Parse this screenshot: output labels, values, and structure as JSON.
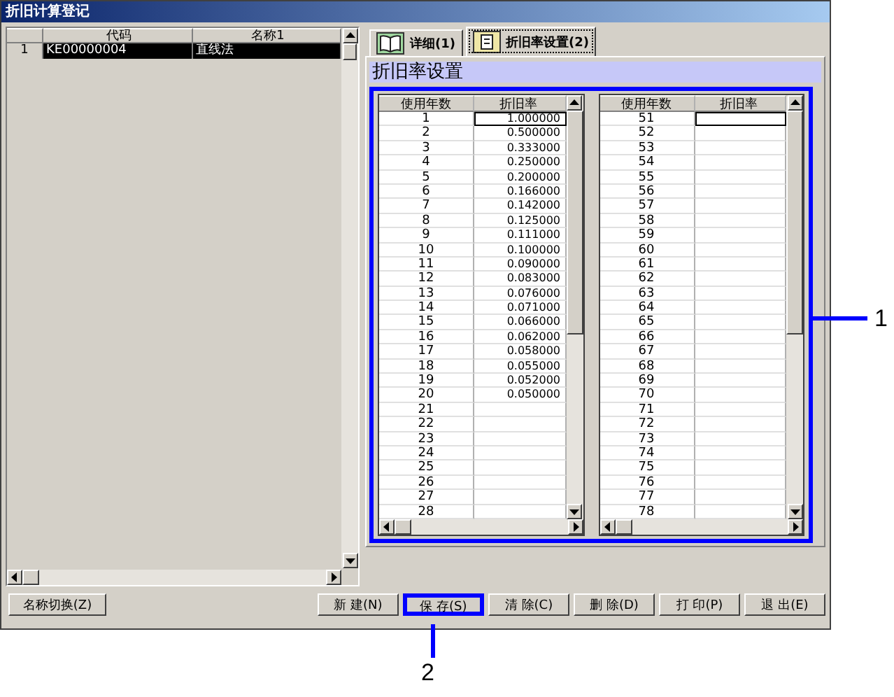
{
  "window": {
    "title": "折旧计算登记"
  },
  "list": {
    "columns": [
      "代码",
      "名称1"
    ],
    "rows": [
      {
        "index": "1",
        "code": "KE00000004",
        "name": "直线法",
        "selected": true
      }
    ]
  },
  "tabs": [
    {
      "label": "详细(1)",
      "selected": false
    },
    {
      "label": "折旧率设置(2)",
      "selected": true
    }
  ],
  "section_title": "折旧率设置",
  "rate_panel_highlighted": true,
  "rate_tables": [
    {
      "columns": [
        "使用年数",
        "折旧率"
      ],
      "rows": [
        {
          "years": "1",
          "rate": "1.000000",
          "focused": true
        },
        {
          "years": "2",
          "rate": "0.500000",
          "focused": false
        },
        {
          "years": "3",
          "rate": "0.333000",
          "focused": false
        },
        {
          "years": "4",
          "rate": "0.250000",
          "focused": false
        },
        {
          "years": "5",
          "rate": "0.200000",
          "focused": false
        },
        {
          "years": "6",
          "rate": "0.166000",
          "focused": false
        },
        {
          "years": "7",
          "rate": "0.142000",
          "focused": false
        },
        {
          "years": "8",
          "rate": "0.125000",
          "focused": false
        },
        {
          "years": "9",
          "rate": "0.111000",
          "focused": false
        },
        {
          "years": "10",
          "rate": "0.100000",
          "focused": false
        },
        {
          "years": "11",
          "rate": "0.090000",
          "focused": false
        },
        {
          "years": "12",
          "rate": "0.083000",
          "focused": false
        },
        {
          "years": "13",
          "rate": "0.076000",
          "focused": false
        },
        {
          "years": "14",
          "rate": "0.071000",
          "focused": false
        },
        {
          "years": "15",
          "rate": "0.066000",
          "focused": false
        },
        {
          "years": "16",
          "rate": "0.062000",
          "focused": false
        },
        {
          "years": "17",
          "rate": "0.058000",
          "focused": false
        },
        {
          "years": "18",
          "rate": "0.055000",
          "focused": false
        },
        {
          "years": "19",
          "rate": "0.052000",
          "focused": false
        },
        {
          "years": "20",
          "rate": "0.050000",
          "focused": false
        },
        {
          "years": "21",
          "focused": false
        },
        {
          "years": "22",
          "focused": false
        },
        {
          "years": "23",
          "focused": false
        },
        {
          "years": "24",
          "focused": false
        },
        {
          "years": "25",
          "focused": false
        },
        {
          "years": "26",
          "focused": false
        },
        {
          "years": "27",
          "focused": false
        },
        {
          "years": "28",
          "focused": false
        }
      ]
    },
    {
      "columns": [
        "使用年数",
        "折旧率"
      ],
      "rows": [
        {
          "years": "51",
          "focused": true
        },
        {
          "years": "52",
          "focused": false
        },
        {
          "years": "53",
          "focused": false
        },
        {
          "years": "54",
          "focused": false
        },
        {
          "years": "55",
          "focused": false
        },
        {
          "years": "56",
          "focused": false
        },
        {
          "years": "57",
          "focused": false
        },
        {
          "years": "58",
          "focused": false
        },
        {
          "years": "59",
          "focused": false
        },
        {
          "years": "60",
          "focused": false
        },
        {
          "years": "61",
          "focused": false
        },
        {
          "years": "62",
          "focused": false
        },
        {
          "years": "63",
          "focused": false
        },
        {
          "years": "64",
          "focused": false
        },
        {
          "years": "65",
          "focused": false
        },
        {
          "years": "66",
          "focused": false
        },
        {
          "years": "67",
          "focused": false
        },
        {
          "years": "68",
          "focused": false
        },
        {
          "years": "69",
          "focused": false
        },
        {
          "years": "70",
          "focused": false
        },
        {
          "years": "71",
          "focused": false
        },
        {
          "years": "72",
          "focused": false
        },
        {
          "years": "73",
          "focused": false
        },
        {
          "years": "74",
          "focused": false
        },
        {
          "years": "75",
          "focused": false
        },
        {
          "years": "76",
          "focused": false
        },
        {
          "years": "77",
          "focused": false
        },
        {
          "years": "78",
          "focused": false
        }
      ]
    }
  ],
  "left_button": {
    "label": "名称切换(Z)"
  },
  "buttons": [
    {
      "label": "新 建(N)",
      "highlighted": false
    },
    {
      "label": "保 存(S)",
      "highlighted": true
    },
    {
      "label": "清 除(C)",
      "highlighted": false
    },
    {
      "label": "删 除(D)",
      "highlighted": false
    },
    {
      "label": "打 印(P)",
      "highlighted": false
    },
    {
      "label": "退 出(E)",
      "highlighted": false
    }
  ],
  "callouts": [
    {
      "label": "1"
    },
    {
      "label": "2"
    }
  ]
}
